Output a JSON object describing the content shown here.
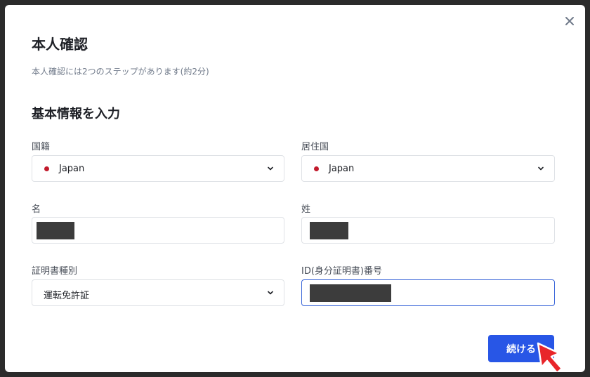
{
  "dialog": {
    "title": "本人確認",
    "subtitle": "本人確認には2つのステップがあります(約2分)",
    "section_title": "基本情報を入力",
    "close_icon": "close-icon"
  },
  "form": {
    "nationality": {
      "label": "国籍",
      "value": "Japan",
      "flag_icon": "japan-flag-icon"
    },
    "residence": {
      "label": "居住国",
      "value": "Japan",
      "flag_icon": "japan-flag-icon"
    },
    "first_name": {
      "label": "名",
      "value_redacted": true
    },
    "last_name": {
      "label": "姓",
      "value_redacted": true
    },
    "document_type": {
      "label": "証明書種別",
      "value": "運転免許証"
    },
    "id_number": {
      "label": "ID(身分証明書)番号",
      "value_redacted": true,
      "focused": true
    }
  },
  "actions": {
    "continue_label": "続ける"
  },
  "colors": {
    "primary": "#2856e6",
    "focus_border": "#3a66d9",
    "flag_red": "#c21a2c",
    "cursor_red": "#e8252a"
  }
}
